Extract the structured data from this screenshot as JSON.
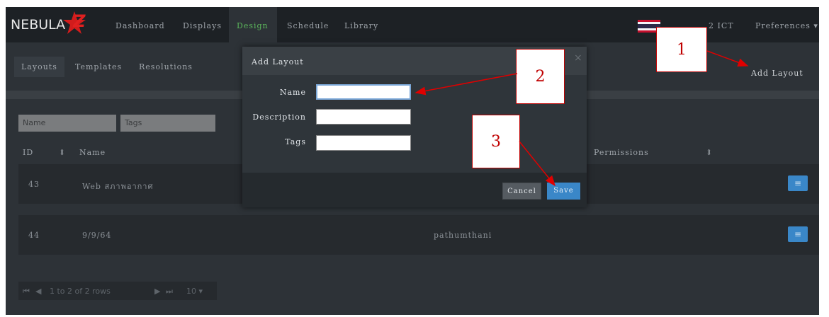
{
  "topnav": {
    "logo_text": "NEBULA",
    "logo_letter": "Z",
    "items": [
      {
        "label": "Dashboard"
      },
      {
        "label": "Displays"
      },
      {
        "label": "Design"
      },
      {
        "label": "Schedule"
      },
      {
        "label": "Library"
      }
    ],
    "active_item": "Design",
    "clock_text": "2 ICT",
    "preferences_label": "Preferences ▾"
  },
  "subnav": {
    "tabs": [
      {
        "label": "Layouts"
      },
      {
        "label": "Templates"
      },
      {
        "label": "Resolutions"
      }
    ],
    "add_layout_label": "Add Layout"
  },
  "filters": {
    "name_placeholder": "Name",
    "tags_placeholder": "Tags"
  },
  "table": {
    "headers": {
      "id": "ID",
      "sort_icon": "⇕",
      "name": "Name",
      "permissions": "Permissions",
      "permissions_sort": "⇕"
    },
    "rows": [
      {
        "id": "43",
        "name": "Web สภาพอากาศ",
        "owner": ""
      },
      {
        "id": "44",
        "name": "9/9/64",
        "owner": "pathumthani"
      }
    ],
    "row_button_icon": "≡"
  },
  "pager": {
    "first_icon": "⏮",
    "prev_icon": "◀",
    "info": "1 to 2 of 2 rows",
    "next_icon": "▶",
    "last_icon": "⏭",
    "page_size": "10 ▾"
  },
  "modal": {
    "title": "Add Layout",
    "close_icon": "×",
    "fields": {
      "name_label": "Name",
      "name_value": "",
      "description_label": "Description",
      "description_value": "",
      "tags_label": "Tags",
      "tags_value": ""
    },
    "cancel_label": "Cancel",
    "save_label": "Save"
  },
  "callouts": [
    "1",
    "2",
    "3"
  ],
  "colors": {
    "background": "#2d3237",
    "navbar": "#1d2125",
    "accent_blue": "#3a87c8",
    "active_green": "#5cb85c",
    "annotation_red": "#e00000"
  }
}
